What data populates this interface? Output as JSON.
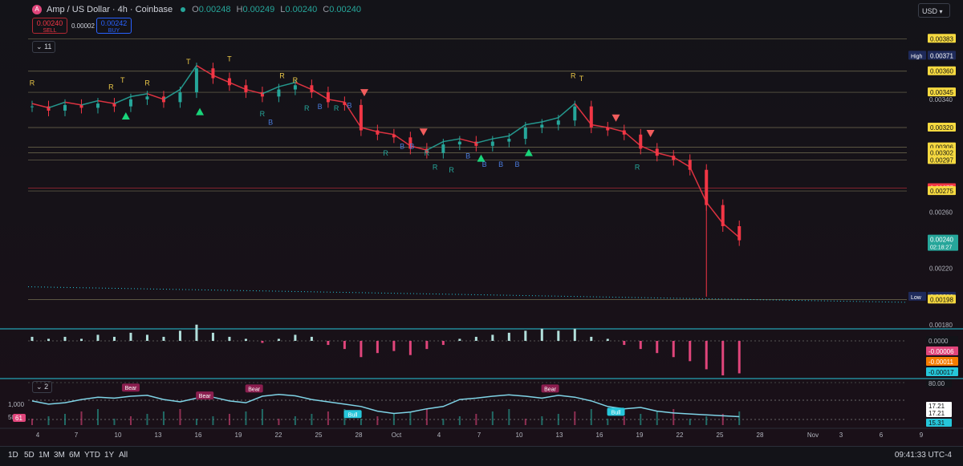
{
  "header": {
    "symbol_icon": "A",
    "title": "Amp / US Dollar · 4h · Coinbase",
    "open_label": "O",
    "open": "0.00248",
    "high_label": "H",
    "high": "0.00249",
    "low_label": "L",
    "low": "0.00240",
    "close_label": "C",
    "close": "0.00240"
  },
  "trade": {
    "sell_price": "0.00240",
    "sell_label": "SELL",
    "spread": "0.00002",
    "buy_price": "0.00242",
    "buy_label": "BUY"
  },
  "indicators_toggle": "11",
  "osc_toggle": "2",
  "currency": "USD",
  "timeframes": [
    "1D",
    "5D",
    "1M",
    "3M",
    "6M",
    "YTD",
    "1Y",
    "All"
  ],
  "clock": "09:41:33 UTC-4",
  "colors": {
    "background": "#131318",
    "up": "#26a69a",
    "down": "#f23645",
    "level": "#d6c98a",
    "accent": "#26c6da"
  },
  "chart_data": [
    {
      "type": "candlestick",
      "x_ticks": [
        "4",
        "7",
        "10",
        "13",
        "16",
        "19",
        "22",
        "25",
        "28",
        "Oct",
        "4",
        "7",
        "10",
        "13",
        "16",
        "19",
        "22",
        "25",
        "28",
        "Nov",
        "3",
        "6",
        "9"
      ],
      "y_ticks": [
        "0.00340",
        "0.00260",
        "0.00220",
        "0.00180"
      ],
      "ylim": [
        0.0018,
        0.0039
      ],
      "price_levels": [
        {
          "label": "0.00383",
          "value": 0.00383,
          "style": "yellow"
        },
        {
          "label": "0.00371",
          "value": 0.00371,
          "style": "blue",
          "tag": "High"
        },
        {
          "label": "0.00360",
          "value": 0.0036,
          "style": "yellow"
        },
        {
          "label": "0.00345",
          "value": 0.00345,
          "style": "yellow"
        },
        {
          "label": "0.00320",
          "value": 0.0032,
          "style": "yellow"
        },
        {
          "label": "0.00306",
          "value": 0.00306,
          "style": "yellow"
        },
        {
          "label": "0.00302",
          "value": 0.00302,
          "style": "yellow"
        },
        {
          "label": "0.00297",
          "value": 0.00297,
          "style": "yellow"
        },
        {
          "label": "0.00277",
          "value": 0.00277,
          "style": "red"
        },
        {
          "label": "0.00275",
          "value": 0.00275,
          "style": "yellow"
        },
        {
          "label": "0.00200",
          "value": 0.002,
          "style": "blue",
          "tag": "Low"
        },
        {
          "label": "0.00198",
          "value": 0.00198,
          "style": "yellow"
        }
      ],
      "last_price": {
        "label": "0.00240",
        "countdown": "02:18:27",
        "value": 0.0024
      },
      "series": [
        {
          "x": 0,
          "y": 0.00335
        },
        {
          "x": 1,
          "y": 0.00332
        },
        {
          "x": 2,
          "y": 0.00336
        },
        {
          "x": 3,
          "y": 0.00334
        },
        {
          "x": 4,
          "y": 0.00337
        },
        {
          "x": 5,
          "y": 0.00335
        },
        {
          "x": 6,
          "y": 0.0034
        },
        {
          "x": 7,
          "y": 0.00342
        },
        {
          "x": 8,
          "y": 0.00338
        },
        {
          "x": 9,
          "y": 0.00345
        },
        {
          "x": 10,
          "y": 0.00362
        },
        {
          "x": 11,
          "y": 0.00355
        },
        {
          "x": 12,
          "y": 0.0035
        },
        {
          "x": 13,
          "y": 0.00345
        },
        {
          "x": 14,
          "y": 0.00342
        },
        {
          "x": 15,
          "y": 0.00347
        },
        {
          "x": 16,
          "y": 0.0035
        },
        {
          "x": 17,
          "y": 0.00345
        },
        {
          "x": 18,
          "y": 0.00338
        },
        {
          "x": 19,
          "y": 0.00336
        },
        {
          "x": 20,
          "y": 0.00318
        },
        {
          "x": 21,
          "y": 0.00315
        },
        {
          "x": 22,
          "y": 0.00313
        },
        {
          "x": 23,
          "y": 0.00305
        },
        {
          "x": 24,
          "y": 0.00302
        },
        {
          "x": 25,
          "y": 0.00308
        },
        {
          "x": 26,
          "y": 0.0031
        },
        {
          "x": 27,
          "y": 0.00307
        },
        {
          "x": 28,
          "y": 0.0031
        },
        {
          "x": 29,
          "y": 0.00312
        },
        {
          "x": 30,
          "y": 0.0032
        },
        {
          "x": 31,
          "y": 0.00322
        },
        {
          "x": 32,
          "y": 0.00325
        },
        {
          "x": 33,
          "y": 0.00335
        },
        {
          "x": 34,
          "y": 0.0032
        },
        {
          "x": 35,
          "y": 0.00318
        },
        {
          "x": 36,
          "y": 0.00315
        },
        {
          "x": 37,
          "y": 0.00305
        },
        {
          "x": 38,
          "y": 0.003
        },
        {
          "x": 39,
          "y": 0.00297
        },
        {
          "x": 40,
          "y": 0.0029
        },
        {
          "x": 41,
          "y": 0.00265
        },
        {
          "x": 42,
          "y": 0.0025
        },
        {
          "x": 43,
          "y": 0.0024
        }
      ],
      "signals": [
        {
          "t": "R",
          "x": 0,
          "y": 0.0035,
          "c": "#e8c547"
        },
        {
          "t": "T",
          "x": 5.5,
          "y": 0.00352,
          "c": "#e8c547"
        },
        {
          "t": "R",
          "x": 4.8,
          "y": 0.00347,
          "c": "#e8c547"
        },
        {
          "t": "R",
          "x": 7,
          "y": 0.0035,
          "c": "#e8c547"
        },
        {
          "t": "T",
          "x": 9.5,
          "y": 0.00365,
          "c": "#e8c547"
        },
        {
          "t": "T",
          "x": 12,
          "y": 0.00367,
          "c": "#e8c547"
        },
        {
          "t": "R",
          "x": 15.2,
          "y": 0.00355,
          "c": "#e8c547"
        },
        {
          "t": "R",
          "x": 16,
          "y": 0.00352,
          "c": "#e8c547"
        },
        {
          "t": "B",
          "x": 14.5,
          "y": 0.00322,
          "c": "#4a7bdc"
        },
        {
          "t": "R",
          "x": 14,
          "y": 0.00328,
          "c": "#26a69a"
        },
        {
          "t": "R",
          "x": 16.7,
          "y": 0.00332,
          "c": "#26a69a"
        },
        {
          "t": "B",
          "x": 17.5,
          "y": 0.00333,
          "c": "#4a7bdc"
        },
        {
          "t": "R",
          "x": 18.5,
          "y": 0.00332,
          "c": "#26a69a"
        },
        {
          "t": "B",
          "x": 19.3,
          "y": 0.00334,
          "c": "#4a7bdc"
        },
        {
          "t": "R",
          "x": 21.5,
          "y": 0.003,
          "c": "#26a69a"
        },
        {
          "t": "B",
          "x": 22.5,
          "y": 0.00305,
          "c": "#4a7bdc"
        },
        {
          "t": "B",
          "x": 23.1,
          "y": 0.00305,
          "c": "#4a7bdc"
        },
        {
          "t": "R",
          "x": 24,
          "y": 0.003,
          "c": "#26a69a"
        },
        {
          "t": "R",
          "x": 24.5,
          "y": 0.0029,
          "c": "#26a69a"
        },
        {
          "t": "R",
          "x": 25.5,
          "y": 0.00288,
          "c": "#26a69a"
        },
        {
          "t": "B",
          "x": 26.5,
          "y": 0.00298,
          "c": "#4a7bdc"
        },
        {
          "t": "B",
          "x": 27.5,
          "y": 0.00292,
          "c": "#4a7bdc"
        },
        {
          "t": "B",
          "x": 28.5,
          "y": 0.00292,
          "c": "#4a7bdc"
        },
        {
          "t": "B",
          "x": 29.5,
          "y": 0.00292,
          "c": "#4a7bdc"
        },
        {
          "t": "R",
          "x": 32.9,
          "y": 0.00355,
          "c": "#e8c547"
        },
        {
          "t": "T",
          "x": 33.4,
          "y": 0.00353,
          "c": "#e8c547"
        },
        {
          "t": "R",
          "x": 36.8,
          "y": 0.0029,
          "c": "#26a69a"
        }
      ],
      "arrows": [
        {
          "dir": "up",
          "x": 5.7,
          "y": 0.00328,
          "c": "#19d47a"
        },
        {
          "dir": "up",
          "x": 10.2,
          "y": 0.00331,
          "c": "#19d47a"
        },
        {
          "dir": "down",
          "x": 20.2,
          "y": 0.00345,
          "c": "#f25d5d"
        },
        {
          "dir": "down",
          "x": 23.8,
          "y": 0.00317,
          "c": "#f25d5d"
        },
        {
          "dir": "up",
          "x": 27.3,
          "y": 0.00298,
          "c": "#19d47a"
        },
        {
          "dir": "up",
          "x": 30.2,
          "y": 0.00302,
          "c": "#19d47a"
        },
        {
          "dir": "down",
          "x": 35.5,
          "y": 0.00327,
          "c": "#f25d5d"
        },
        {
          "dir": "down",
          "x": 37.6,
          "y": 0.00316,
          "c": "#f25d5d"
        }
      ]
    },
    {
      "type": "bar",
      "title": "",
      "value_labels": [
        "0.0000",
        "-0.00006",
        "-0.00011",
        "-0.00017"
      ],
      "values": [
        2e-05,
        1e-05,
        2e-05,
        1e-05,
        3e-05,
        2e-05,
        4e-05,
        3e-05,
        2e-05,
        5e-05,
        8e-05,
        4e-05,
        2e-05,
        1e-05,
        -1e-05,
        1e-05,
        3e-05,
        2e-05,
        -2e-05,
        -4e-05,
        -8e-05,
        -6e-05,
        -5e-05,
        -7e-05,
        -4e-05,
        -2e-05,
        1e-05,
        2e-05,
        3e-05,
        4e-05,
        5e-05,
        6e-05,
        5e-05,
        6e-05,
        2e-05,
        1e-05,
        -2e-05,
        -4e-05,
        -6e-05,
        -8e-05,
        -0.0001,
        -0.00014,
        -0.00017,
        -0.00016
      ]
    },
    {
      "type": "line",
      "y_ticks": [
        "1,000",
        "500"
      ],
      "right_labels": [
        "80.00",
        "17.21",
        "17.21",
        "15.31"
      ],
      "left_value": "61",
      "annotations": [
        {
          "t": "Bear",
          "x": 6,
          "v": 72,
          "c": "#8b1e4f"
        },
        {
          "t": "Bear",
          "x": 10.5,
          "v": 55,
          "c": "#8b1e4f"
        },
        {
          "t": "Bear",
          "x": 13.5,
          "v": 70,
          "c": "#8b1e4f"
        },
        {
          "t": "Bull",
          "x": 19.5,
          "v": 15,
          "c": "#26c6da"
        },
        {
          "t": "Bear",
          "x": 31.5,
          "v": 70,
          "c": "#8b1e4f"
        },
        {
          "t": "Bull",
          "x": 35.5,
          "v": 20,
          "c": "#26c6da"
        }
      ],
      "values": [
        52,
        45,
        48,
        55,
        60,
        58,
        62,
        64,
        55,
        50,
        58,
        60,
        52,
        48,
        62,
        66,
        63,
        55,
        50,
        45,
        40,
        30,
        25,
        28,
        35,
        40,
        55,
        58,
        62,
        65,
        62,
        58,
        64,
        60,
        52,
        40,
        35,
        38,
        30,
        26,
        24,
        22,
        20,
        18
      ]
    }
  ]
}
